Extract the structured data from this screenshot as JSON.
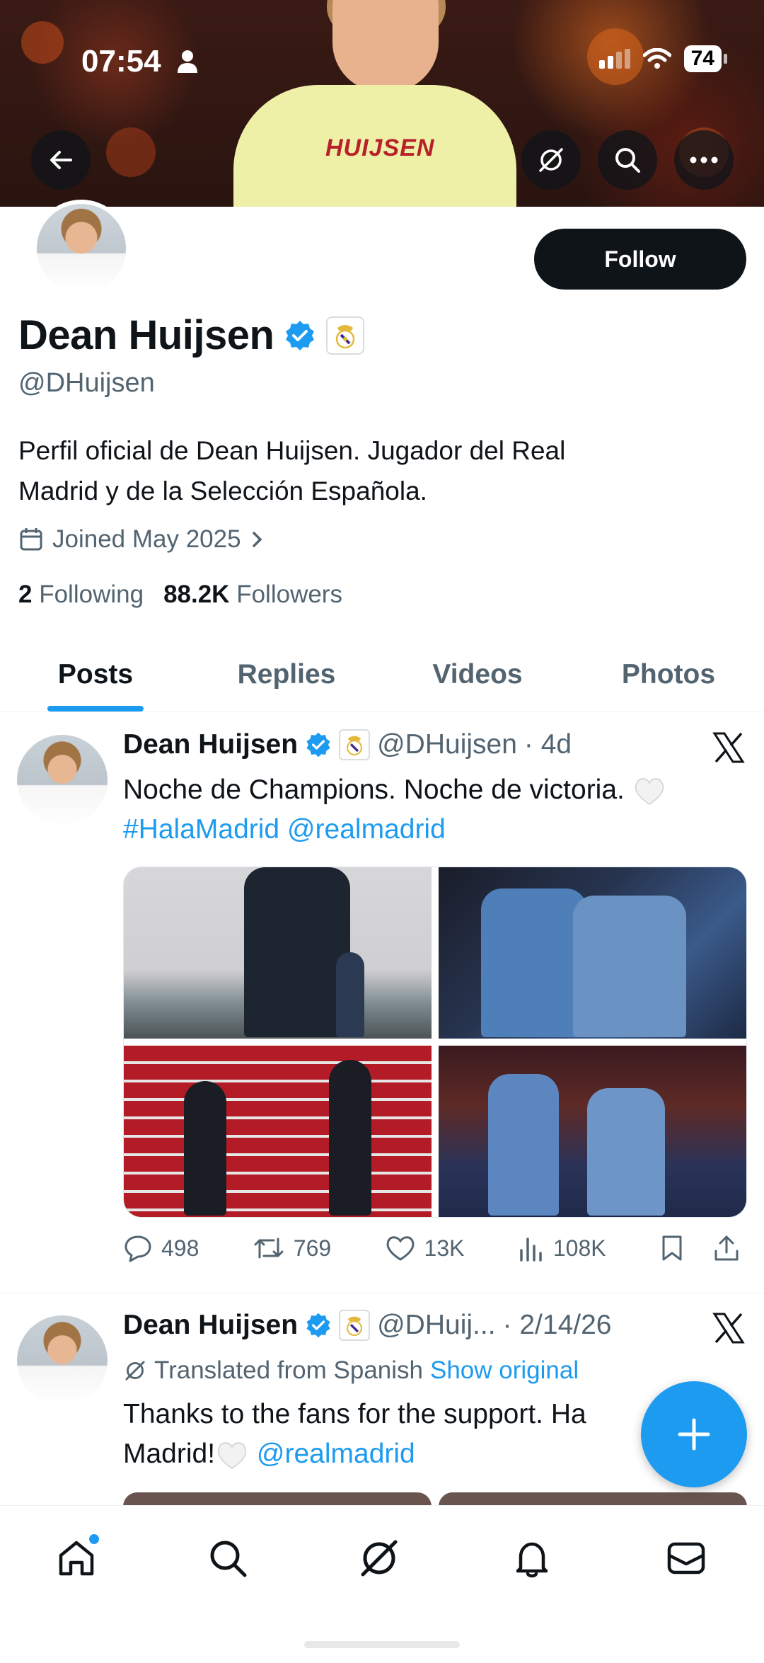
{
  "status_bar": {
    "time": "07:54",
    "battery": "74"
  },
  "banner": {
    "jersey_name": "HUIJSEN"
  },
  "profile": {
    "name": "Dean Huijsen",
    "handle": "@DHuijsen",
    "bio_line1": "Perfil oficial de Dean Huijsen. Jugador del Real",
    "bio_line2": "Madrid y de la Selección Española.",
    "joined": "Joined May 2025",
    "following_count": "2",
    "following_label": "Following",
    "followers_count": "88.2K",
    "followers_label": "Followers",
    "follow_label": "Follow"
  },
  "tabs": [
    {
      "label": "Posts",
      "active": true
    },
    {
      "label": "Replies",
      "active": false
    },
    {
      "label": "Videos",
      "active": false
    },
    {
      "label": "Photos",
      "active": false
    }
  ],
  "posts": [
    {
      "name": "Dean Huijsen",
      "handle": "@DHuijsen",
      "time": "· 4d",
      "text": "Noche de Champions. Noche de victoria.",
      "hashtag": "#HalaMadrid",
      "mention": "@realmadrid",
      "replies": "498",
      "reposts": "769",
      "likes": "13K",
      "views": "108K"
    },
    {
      "name": "Dean Huijsen",
      "handle": "@DHuij...",
      "time": "· 2/14/26",
      "translated": "Translated from Spanish",
      "show_original": "Show original",
      "text_line1": "Thanks to the fans for the support. Ha",
      "text_line2": "Madrid!",
      "mention": "@realmadrid"
    }
  ],
  "colors": {
    "accent": "#1d9bf0",
    "text": "#0f1419",
    "secondary": "#536471"
  },
  "icons": [
    "back-arrow-icon",
    "grok-icon",
    "search-icon",
    "more-icon",
    "verified-icon",
    "calendar-icon",
    "chevron-right-icon",
    "x-logo-icon",
    "reply-icon",
    "repost-icon",
    "like-icon",
    "views-icon",
    "bookmark-icon",
    "share-icon",
    "plus-icon",
    "home-icon",
    "notifications-icon",
    "messages-icon"
  ]
}
